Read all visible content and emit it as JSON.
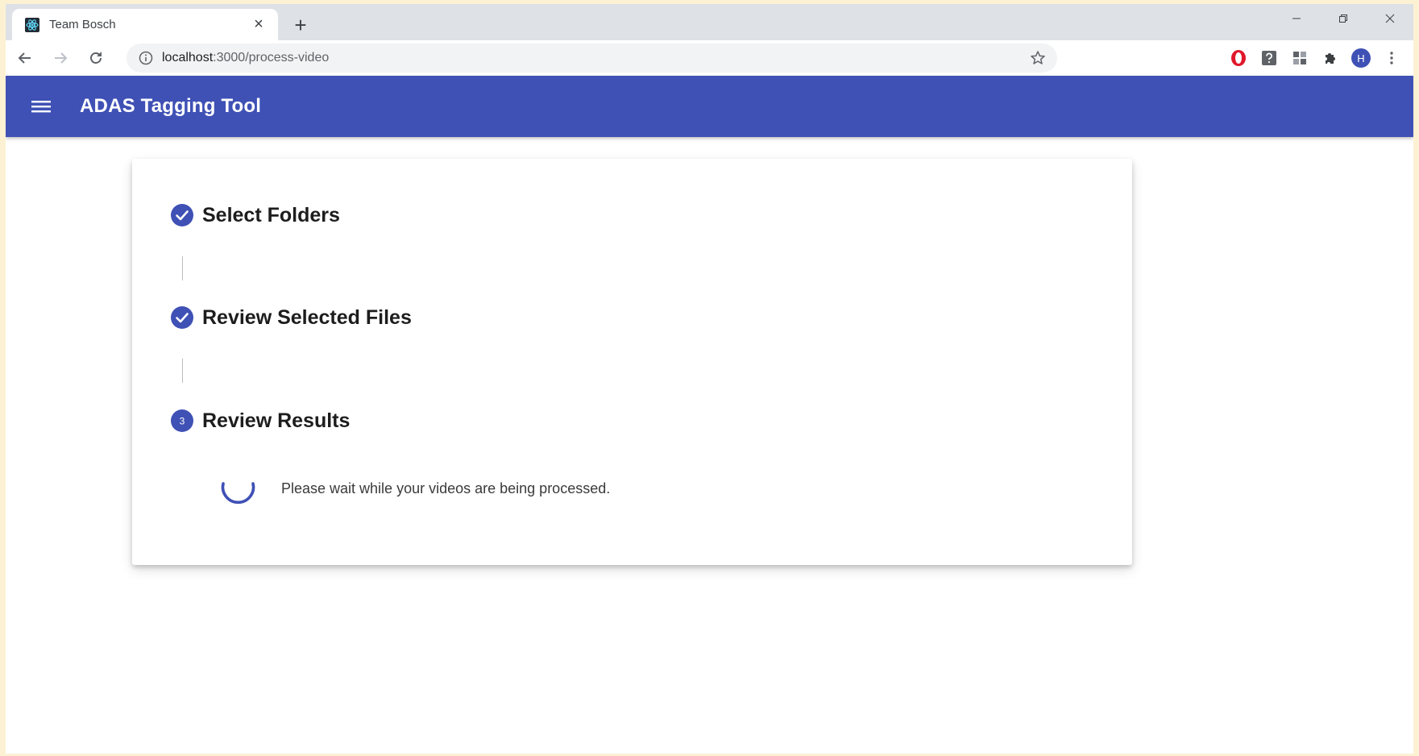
{
  "browser": {
    "tab": {
      "title": "Team Bosch",
      "close_symbol": "×"
    },
    "new_tab_symbol": "+",
    "url": {
      "host": "localhost",
      "path": ":3000/process-video"
    },
    "profile_initial": "H"
  },
  "app": {
    "title": "ADAS Tagging Tool",
    "primary_color": "#3f51b5"
  },
  "stepper": {
    "steps": [
      {
        "label": "Select Folders",
        "status": "completed",
        "icon": "check-circle-icon"
      },
      {
        "label": "Review Selected Files",
        "status": "completed",
        "icon": "check-circle-icon"
      },
      {
        "label": "Review Results",
        "status": "active",
        "number": "3"
      }
    ],
    "processing_message": "Please wait while your videos are being processed."
  }
}
